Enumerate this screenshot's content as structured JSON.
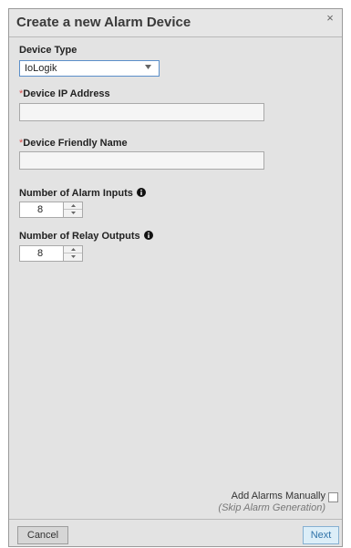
{
  "dialog": {
    "title": "Create a new Alarm Device",
    "close_glyph": "×"
  },
  "device_type": {
    "label": "Device Type",
    "selected": "IoLogik"
  },
  "ip_address": {
    "required_mark": "*",
    "label": "Device IP Address",
    "value": ""
  },
  "friendly_name": {
    "required_mark": "*",
    "label": "Device Friendly Name",
    "value": ""
  },
  "alarm_inputs": {
    "label": "Number of Alarm Inputs",
    "value": "8",
    "icon": "info-icon"
  },
  "relay_outputs": {
    "label": "Number of Relay Outputs",
    "value": "8",
    "icon": "info-icon"
  },
  "manual": {
    "label": "Add Alarms Manually",
    "sublabel": "(Skip Alarm Generation)",
    "checked": false
  },
  "footer": {
    "cancel_label": "Cancel",
    "next_label": "Next"
  },
  "colors": {
    "dialog_bg": "#e3e3e3",
    "select_border": "#5b8fc9",
    "required": "#d9534f",
    "next_text": "#2f72a8"
  }
}
